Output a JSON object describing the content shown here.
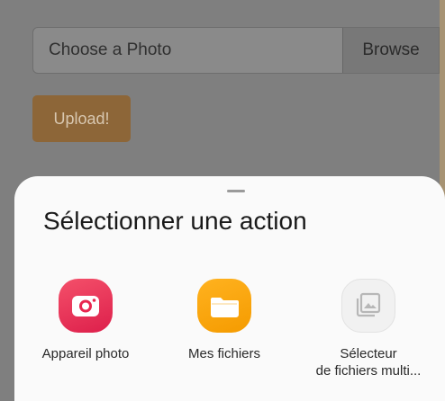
{
  "form": {
    "file_placeholder": "Choose a Photo",
    "browse_label": "Browse",
    "upload_label": "Upload!"
  },
  "sheet": {
    "title": "Sélectionner une action",
    "actions": [
      {
        "label": "Appareil photo",
        "icon": "camera-icon",
        "color": "#e8264f"
      },
      {
        "label": "Mes fichiers",
        "icon": "folder-icon",
        "color": "#f7a30d"
      },
      {
        "label_line1": "Sélecteur",
        "label_line2": "de fichiers multi...",
        "icon": "gallery-icon",
        "color": "#bdbdbd"
      }
    ]
  },
  "colors": {
    "overlay": "#7f7f7f",
    "upload_button": "#8d6638",
    "sheet_background": "#fafafa"
  }
}
